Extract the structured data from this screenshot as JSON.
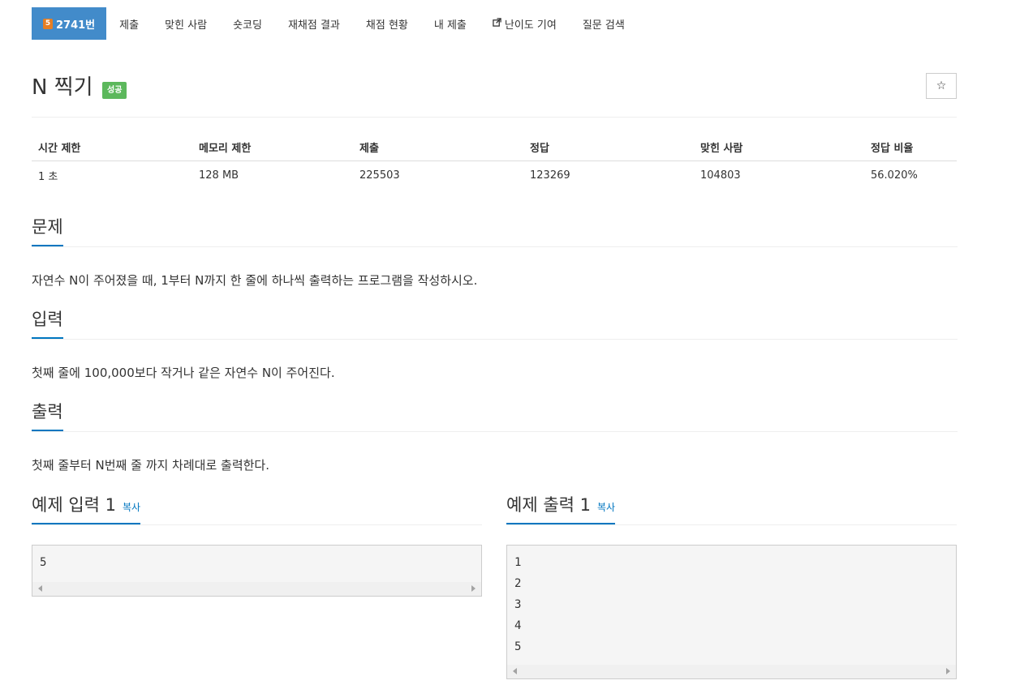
{
  "tabs": [
    {
      "label": "2741번",
      "badge": "5",
      "active": true
    },
    {
      "label": "제출"
    },
    {
      "label": "맞힌 사람"
    },
    {
      "label": "숏코딩"
    },
    {
      "label": "재채점 결과"
    },
    {
      "label": "채점 현황"
    },
    {
      "label": "내 제출"
    },
    {
      "label": "난이도 기여",
      "icon": "external-link-icon"
    },
    {
      "label": "질문 검색"
    }
  ],
  "problem": {
    "title": "N 찍기",
    "status": "성공",
    "star_glyph": "☆"
  },
  "info": {
    "headers": [
      "시간 제한",
      "메모리 제한",
      "제출",
      "정답",
      "맞힌 사람",
      "정답 비율"
    ],
    "values": [
      "1 초",
      "128 MB",
      "225503",
      "123269",
      "104803",
      "56.020%"
    ]
  },
  "sections": {
    "description": {
      "heading": "문제",
      "text": "자연수 N이 주어졌을 때, 1부터 N까지 한 줄에 하나씩 출력하는 프로그램을 작성하시오."
    },
    "input": {
      "heading": "입력",
      "text": "첫째 줄에 100,000보다 작거나 같은 자연수 N이 주어진다."
    },
    "output": {
      "heading": "출력",
      "text": "첫째 줄부터 N번째 줄 까지 차례대로 출력한다."
    }
  },
  "samples": {
    "input": {
      "title": "예제 입력 1",
      "copy_label": "복사",
      "lines": [
        "5"
      ]
    },
    "output": {
      "title": "예제 출력 1",
      "copy_label": "복사",
      "lines": [
        "1",
        "2",
        "3",
        "4",
        "5"
      ]
    }
  },
  "colors": {
    "active_tab": "#428bca",
    "success_badge": "#5cb85c",
    "accent_link": "#0076c0",
    "tier_badge": "#e67e22"
  }
}
